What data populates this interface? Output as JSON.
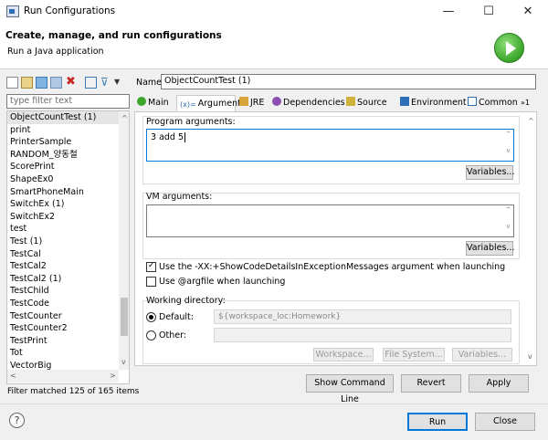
{
  "window": {
    "title": "Run Configurations",
    "minimize_glyph": "—",
    "maximize_glyph": "☐",
    "close_glyph": "✕"
  },
  "header": {
    "title": "Create, manage, and run configurations",
    "subtitle": "Run a Java application"
  },
  "left": {
    "filter_placeholder": "type filter text",
    "items": [
      "ObjectCountTest (1)",
      "print",
      "PrinterSample",
      "RANDOM_양동철",
      "ScorePrint",
      "ShapeEx0",
      "SmartPhoneMain",
      "SwitchEx (1)",
      "SwitchEx2",
      "test",
      "Test (1)",
      "TestCal",
      "TestCal2",
      "TestCal2 (1)",
      "TestChild",
      "TestCode",
      "TestCounter",
      "TestCounter2",
      "TestPrint",
      "Tot",
      "VectorBig"
    ],
    "selected_index": 0,
    "status": "Filter matched 125 of 165 items"
  },
  "form": {
    "name_label": "Name:",
    "name_value": "ObjectCountTest (1)",
    "tabs": [
      "Main",
      "Arguments",
      "JRE",
      "Dependencies",
      "Source",
      "Environment",
      "Common",
      "»1"
    ],
    "active_tab": "Arguments",
    "program_args_label": "Program arguments:",
    "program_args_value": "3 add 5",
    "variables_label": "Variables...",
    "vm_args_label": "VM arguments:",
    "vm_args_value": "",
    "show_code_details_label": "Use the -XX:+ShowCodeDetailsInExceptionMessages argument when launching",
    "show_code_details_checked": true,
    "argfile_label": "Use @argfile when launching",
    "argfile_checked": false,
    "working_dir_label": "Working directory:",
    "default_label": "Default:",
    "default_value": "${workspace_loc:Homework}",
    "other_label": "Other:",
    "other_value": "",
    "workspace_btn": "Workspace...",
    "filesystem_btn": "File System...",
    "wd_variables_btn": "Variables..."
  },
  "buttons": {
    "show_cmd": "Show Command Line",
    "revert": "Revert",
    "apply": "Apply",
    "run": "Run",
    "close": "Close"
  },
  "colors": {
    "accent": "#0078d7",
    "run_green": "#3aa52a"
  }
}
